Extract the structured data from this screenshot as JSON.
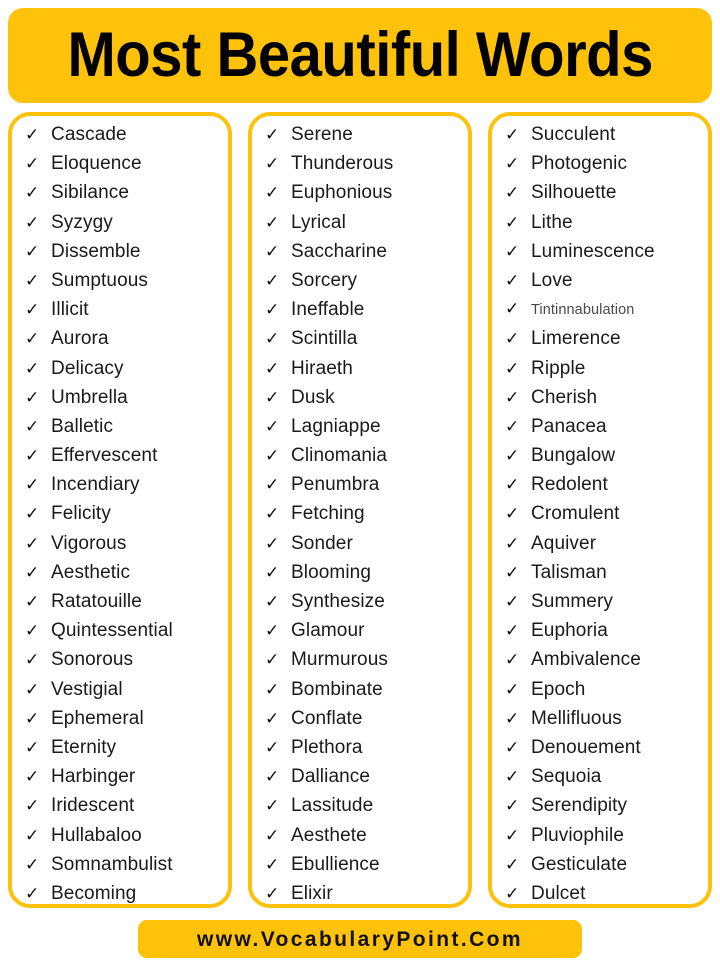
{
  "header": {
    "title": "Most Beautiful Words",
    "background_color": "#FFC20A",
    "text_color": "#000000"
  },
  "theme": {
    "accent_color": "#FFC20A",
    "card_border_color": "#FFC20A",
    "page_background": "#FFFFFF",
    "text_color": "#1A1A1A",
    "muted_text_color": "#4A4A4A"
  },
  "bullet": {
    "icon": "check-icon",
    "glyph": "✓"
  },
  "columns": [
    {
      "index": 1,
      "items": [
        {
          "word": "Cascade",
          "size": "normal"
        },
        {
          "word": "Eloquence",
          "size": "normal"
        },
        {
          "word": "Sibilance",
          "size": "normal"
        },
        {
          "word": "Syzygy",
          "size": "normal"
        },
        {
          "word": "Dissemble",
          "size": "normal"
        },
        {
          "word": "Sumptuous",
          "size": "normal"
        },
        {
          "word": "Illicit",
          "size": "normal"
        },
        {
          "word": "Aurora",
          "size": "normal"
        },
        {
          "word": "Delicacy",
          "size": "normal"
        },
        {
          "word": "Umbrella",
          "size": "normal"
        },
        {
          "word": "Balletic",
          "size": "normal"
        },
        {
          "word": "Effervescent",
          "size": "normal"
        },
        {
          "word": "Incendiary",
          "size": "normal"
        },
        {
          "word": "Felicity",
          "size": "normal"
        },
        {
          "word": "Vigorous",
          "size": "normal"
        },
        {
          "word": "Aesthetic",
          "size": "normal"
        },
        {
          "word": "Ratatouille",
          "size": "normal"
        },
        {
          "word": "Quintessential",
          "size": "normal"
        },
        {
          "word": "Sonorous",
          "size": "normal"
        },
        {
          "word": "Vestigial",
          "size": "normal"
        },
        {
          "word": "Ephemeral",
          "size": "normal"
        },
        {
          "word": "Eternity",
          "size": "normal"
        },
        {
          "word": "Harbinger",
          "size": "normal"
        },
        {
          "word": "Iridescent",
          "size": "normal"
        },
        {
          "word": "Hullabaloo",
          "size": "normal"
        },
        {
          "word": "Somnambulist",
          "size": "normal"
        },
        {
          "word": "Becoming",
          "size": "normal"
        }
      ]
    },
    {
      "index": 2,
      "items": [
        {
          "word": "Serene",
          "size": "normal"
        },
        {
          "word": "Thunderous",
          "size": "normal"
        },
        {
          "word": "Euphonious",
          "size": "normal"
        },
        {
          "word": "Lyrical",
          "size": "normal"
        },
        {
          "word": "Saccharine",
          "size": "normal"
        },
        {
          "word": "Sorcery",
          "size": "normal"
        },
        {
          "word": "Ineffable",
          "size": "normal"
        },
        {
          "word": "Scintilla",
          "size": "normal"
        },
        {
          "word": "Hiraeth",
          "size": "normal"
        },
        {
          "word": "Dusk",
          "size": "normal"
        },
        {
          "word": "Lagniappe",
          "size": "normal"
        },
        {
          "word": "Clinomania",
          "size": "normal"
        },
        {
          "word": "Penumbra",
          "size": "normal"
        },
        {
          "word": "Fetching",
          "size": "normal"
        },
        {
          "word": "Sonder",
          "size": "normal"
        },
        {
          "word": "Blooming",
          "size": "normal"
        },
        {
          "word": "Synthesize",
          "size": "normal"
        },
        {
          "word": "Glamour",
          "size": "normal"
        },
        {
          "word": "Murmurous",
          "size": "normal"
        },
        {
          "word": "Bombinate",
          "size": "normal"
        },
        {
          "word": "Conflate",
          "size": "normal"
        },
        {
          "word": "Plethora",
          "size": "normal"
        },
        {
          "word": "Dalliance",
          "size": "normal"
        },
        {
          "word": "Lassitude",
          "size": "normal"
        },
        {
          "word": "Aesthete",
          "size": "normal"
        },
        {
          "word": "Ebullience",
          "size": "normal"
        },
        {
          "word": "Elixir",
          "size": "normal"
        }
      ]
    },
    {
      "index": 3,
      "items": [
        {
          "word": "Succulent",
          "size": "normal"
        },
        {
          "word": "Photogenic",
          "size": "normal"
        },
        {
          "word": "Silhouette",
          "size": "normal"
        },
        {
          "word": "Lithe",
          "size": "normal"
        },
        {
          "word": "Luminescence",
          "size": "normal"
        },
        {
          "word": "Love",
          "size": "normal"
        },
        {
          "word": "Tintinnabulation",
          "size": "small"
        },
        {
          "word": "Limerence",
          "size": "normal"
        },
        {
          "word": "Ripple",
          "size": "normal"
        },
        {
          "word": "Cherish",
          "size": "normal"
        },
        {
          "word": "Panacea",
          "size": "normal"
        },
        {
          "word": "Bungalow",
          "size": "normal"
        },
        {
          "word": "Redolent",
          "size": "normal"
        },
        {
          "word": "Cromulent",
          "size": "normal"
        },
        {
          "word": "Aquiver",
          "size": "normal"
        },
        {
          "word": "Talisman",
          "size": "normal"
        },
        {
          "word": "Summery",
          "size": "normal"
        },
        {
          "word": "Euphoria",
          "size": "normal"
        },
        {
          "word": "Ambivalence",
          "size": "normal"
        },
        {
          "word": "Epoch",
          "size": "normal"
        },
        {
          "word": "Mellifluous",
          "size": "normal"
        },
        {
          "word": "Denouement",
          "size": "normal"
        },
        {
          "word": "Sequoia",
          "size": "normal"
        },
        {
          "word": "Serendipity",
          "size": "normal"
        },
        {
          "word": "Pluviophile",
          "size": "normal"
        },
        {
          "word": "Gesticulate",
          "size": "normal"
        },
        {
          "word": "Dulcet",
          "size": "normal"
        }
      ]
    }
  ],
  "footer": {
    "website": "www.VocabularyPoint.Com",
    "background_color": "#FFC20A"
  }
}
